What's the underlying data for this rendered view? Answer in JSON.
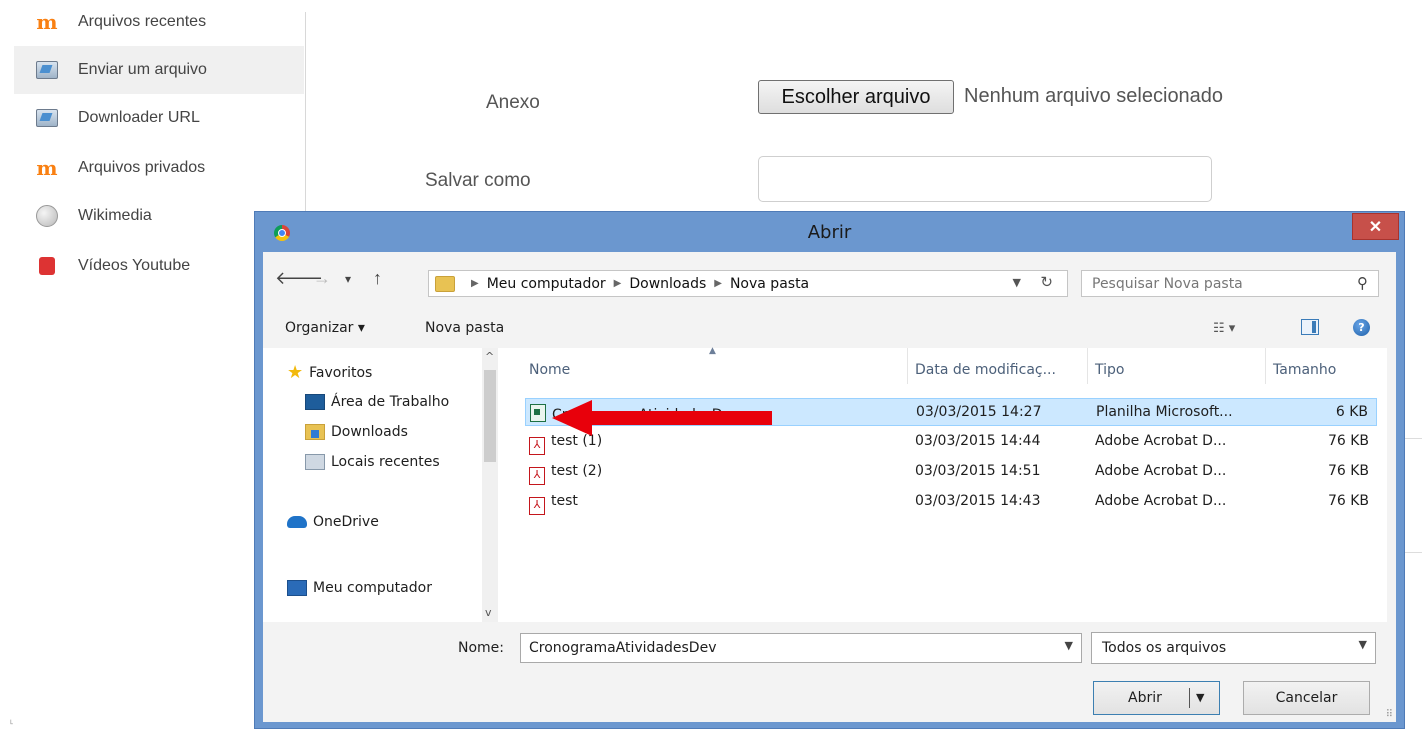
{
  "repositories": [
    {
      "label": "Arquivos recentes",
      "icon": "moodle-icon"
    },
    {
      "label": "Enviar um arquivo",
      "icon": "upload-icon",
      "active": true
    },
    {
      "label": "Downloader URL",
      "icon": "url-download-icon"
    },
    {
      "label": "Arquivos privados",
      "icon": "moodle-icon"
    },
    {
      "label": "Wikimedia",
      "icon": "wikimedia-icon"
    },
    {
      "label": "Vídeos Youtube",
      "icon": "youtube-icon"
    }
  ],
  "form": {
    "attachment_label": "Anexo",
    "choose_button": "Escolher arquivo",
    "no_file_text": "Nenhum arquivo selecionado",
    "save_as_label": "Salvar como",
    "save_as_value": ""
  },
  "dialog": {
    "title": "Abrir",
    "close_symbol": "✕",
    "nav": {
      "back_symbol": "🡐",
      "forward_symbol": "→",
      "recent_symbol": "▾",
      "up_symbol": "↑"
    },
    "breadcrumb": [
      "Meu computador",
      "Downloads",
      "Nova pasta"
    ],
    "search_placeholder": "Pesquisar Nova pasta",
    "toolbar": {
      "organize": "Organizar ▾",
      "new_folder": "Nova pasta"
    },
    "nav_pane": {
      "favorites": "Favoritos",
      "desktop": "Área de Trabalho",
      "downloads": "Downloads",
      "recent_places": "Locais recentes",
      "onedrive": "OneDrive",
      "computer": "Meu computador"
    },
    "columns": {
      "name": "Nome",
      "date": "Data de modificaç...",
      "type": "Tipo",
      "size": "Tamanho"
    },
    "files": [
      {
        "name": "CronogramaAtividadesDev",
        "date": "03/03/2015 14:27",
        "type": "Planilha Microsoft...",
        "size": "6 KB",
        "icon": "spreadsheet-icon",
        "selected": true
      },
      {
        "name": "test (1)",
        "date": "03/03/2015 14:44",
        "type": "Adobe Acrobat D...",
        "size": "76 KB",
        "icon": "pdf-icon"
      },
      {
        "name": "test (2)",
        "date": "03/03/2015 14:51",
        "type": "Adobe Acrobat D...",
        "size": "76 KB",
        "icon": "pdf-icon"
      },
      {
        "name": "test",
        "date": "03/03/2015 14:43",
        "type": "Adobe Acrobat D...",
        "size": "76 KB",
        "icon": "pdf-icon"
      }
    ],
    "file_name_label": "Nome:",
    "file_name_value": "CronogramaAtividadesDev",
    "file_type_value": "Todos os arquivos",
    "open_button": "Abrir",
    "cancel_button": "Cancelar"
  },
  "annotation_color": "#e8000b"
}
